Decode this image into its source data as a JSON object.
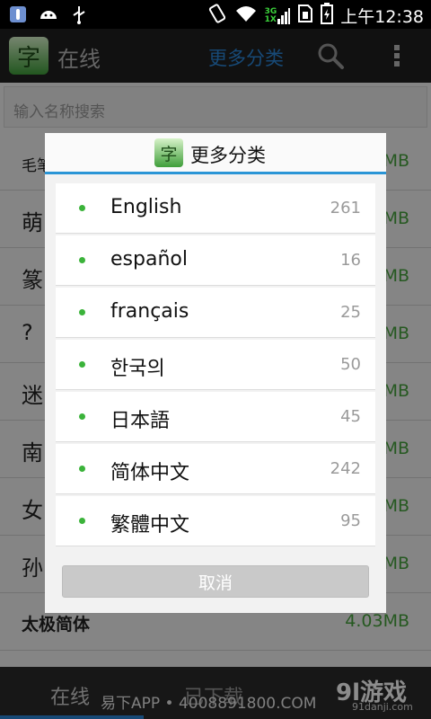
{
  "status_bar": {
    "time": "上午12:38",
    "network": "3G",
    "network_sub": "1X",
    "icons": [
      "usb-debug-icon",
      "android-icon",
      "usb-icon",
      "vibrate-icon",
      "wifi-icon",
      "signal-icon",
      "sim-icon",
      "battery-icon"
    ]
  },
  "action_bar": {
    "title": "在线",
    "more_categories": "更多分类",
    "logo_char": "字"
  },
  "search": {
    "placeholder": "输入名称搜索"
  },
  "font_list": [
    {
      "name": "毛笔",
      "size": "MB"
    },
    {
      "name": "萌",
      "size": "MB"
    },
    {
      "name": "篆",
      "size": "MB"
    },
    {
      "name": "?",
      "size": "MB"
    },
    {
      "name": "迷",
      "size": "MB"
    },
    {
      "name": "南",
      "size": "MB"
    },
    {
      "name": "女",
      "size": "MB"
    },
    {
      "name": "孙",
      "size": "MB"
    },
    {
      "name": "太极简体",
      "size": "4.03MB"
    }
  ],
  "dialog": {
    "title": "更多分类",
    "icon_char": "字",
    "languages": [
      {
        "name": "English",
        "count": "261"
      },
      {
        "name": "español",
        "count": "16"
      },
      {
        "name": "français",
        "count": "25"
      },
      {
        "name": "한국의",
        "count": "50"
      },
      {
        "name": "日本語",
        "count": "45"
      },
      {
        "name": "简体中文",
        "count": "242"
      },
      {
        "name": "繁體中文",
        "count": "95"
      }
    ],
    "cancel_label": "取消"
  },
  "bottom_tabs": {
    "online": "在线",
    "downloaded": "已下载"
  },
  "watermark": {
    "left": "易下APP • 4008891800.COM",
    "brand": "9l游戏",
    "domain": "91danji.com"
  },
  "colors": {
    "accent_blue": "#2a86d8",
    "accent_green": "#46a23c",
    "dialog_divider": "#2a95d6"
  }
}
